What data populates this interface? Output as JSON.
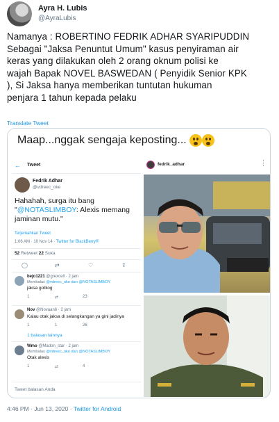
{
  "author": {
    "name": "Ayra H. Lubis",
    "handle": "@AyraLubis"
  },
  "tweet": {
    "lines": [
      "Namanya : ROBERTINO FEDRIK ADHAR SYARIPUDDIN",
      "Sebagai \"Jaksa Penuntut Umum\" kasus penyiraman air",
      "keras yang dilakukan oleh 2 orang oknum polisi ke",
      "wajah Bapak NOVEL BASWEDAN ( Penyidik Senior KPK",
      "), Si Jaksa hanya memberikan tuntutan hukuman",
      "penjara 1 tahun kepada pelaku"
    ],
    "translate_label": "Translate Tweet",
    "timestamp": "4:46 PM · Jun 13, 2020 · ",
    "source": "Twitter for Android"
  },
  "media": {
    "caption": "Maap...nggak sengaja keposting...",
    "embedded_tweet": {
      "nav_label": "Tweet",
      "name": "Fedrik Adhar",
      "handle": "@vdreec_oke",
      "body_pre": "Hahahah, surga itu bang \"",
      "body_mention": "@NOTASLIMBOY",
      "body_post": ": Alexis memang jaminan mutu.\"",
      "translate": "Terjemahkan Tweet",
      "meta": "1:06 AM · 10 Nov 14 · ",
      "meta_source": "Twitter for BlackBerry®",
      "retweets": "52",
      "retweets_label": "Retweet",
      "likes": "22",
      "likes_label": "Suka",
      "replies": [
        {
          "user": "bejo1221",
          "meta": "@grexcell · 2 jam",
          "reply_to": "Membalas ",
          "reply_to_users": "@vdreec_oke dan @NOTASLIMBOY",
          "text": "jaksa goblog",
          "count_reply": "1",
          "count_rt": "",
          "count_like": "23"
        },
        {
          "user": "Nov",
          "meta": "@Novaan6 · 2 jam",
          "reply_to": "",
          "reply_to_users": "",
          "text": "Kalau otak jaksa di selangkangan ya gini jadinya",
          "count_reply": "1",
          "count_rt": "1",
          "count_like": "26"
        },
        {
          "user": "Wmo",
          "meta": "@Madon_star · 2 jam",
          "reply_to": "Membalas ",
          "reply_to_users": "@vdreec_oke dan @NOTASLIMBOY",
          "text": "Otak alexis",
          "count_reply": "1",
          "count_rt": "",
          "count_like": "4"
        }
      ],
      "more_replies": "1 balasan lainnya",
      "input_placeholder": "Tweet balasan Anda"
    },
    "instagram": {
      "username": "fedrik_adhar"
    }
  }
}
